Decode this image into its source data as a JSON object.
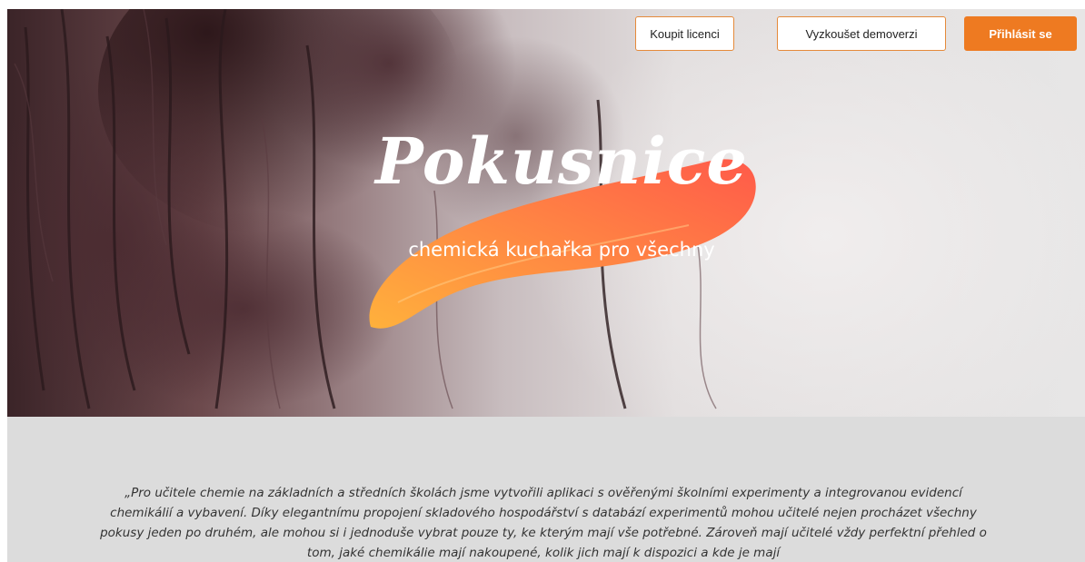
{
  "header": {
    "buy_license": "Koupit licenci",
    "try_demo": "Vyzkoušet demoverzi",
    "login": "Přihlásit se"
  },
  "hero": {
    "title": "Pokusnice",
    "subtitle": "chemická kuchařka pro všechny"
  },
  "intro": {
    "text": "„Pro učitele chemie na základních a středních školách jsme vytvořili aplikaci s ověřenými školními experimenty a integrovanou evidencí chemikálií a vybavení. Díky elegantnímu propojení skladového hospodářství s databází experimentů mohou učitelé nejen procházet všechny pokusy jeden po druhém, ale mohou si i jednoduše vybrat pouze ty, ke kterým mají vše potřebné. Zároveň mají učitelé vždy perfektní přehled o tom, jaké chemikálie mají nakoupené, kolik jich mají k dispozici a kde je mají"
  },
  "colors": {
    "accent": "#ee7a21",
    "brush_start": "#ffb13c",
    "brush_end": "#ff5a4a"
  }
}
